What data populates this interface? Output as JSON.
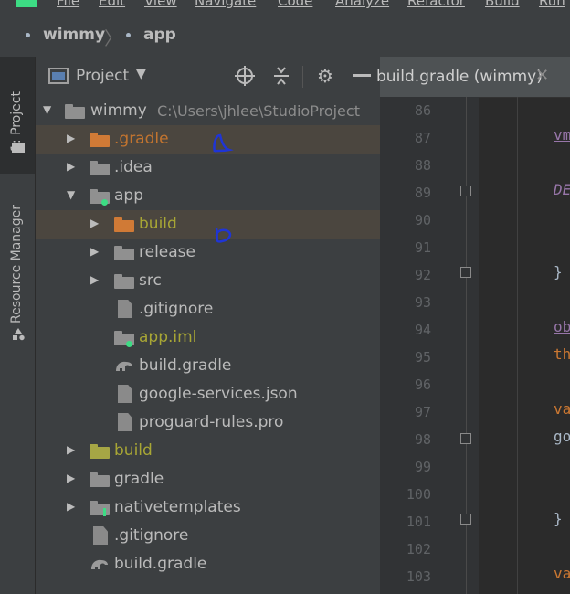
{
  "menu": {
    "items": [
      "File",
      "Edit",
      "View",
      "Navigate",
      "Code",
      "Analyze",
      "Refactor",
      "Build",
      "Run"
    ]
  },
  "breadcrumb": {
    "project": "wimmy",
    "module": "app"
  },
  "toolstrip": {
    "project_tab": "1: Project",
    "resource_tab": "Resource Manager"
  },
  "panel": {
    "title": "Project",
    "icons": [
      "locate-icon",
      "collapse-icon",
      "gear-icon",
      "minimize-icon"
    ]
  },
  "tree": {
    "root": {
      "label": "wimmy",
      "path": "C:\\Users\\jhlee\\StudioProject"
    },
    "items": [
      {
        "label": ".gradle",
        "color": "#c2742f"
      },
      {
        "label": ".idea",
        "color": "#bbbbbb"
      },
      {
        "label": "app",
        "color": "#bbbbbb"
      },
      {
        "label": "build",
        "color": "#a8a635"
      },
      {
        "label": "release",
        "color": "#bbbbbb"
      },
      {
        "label": "src",
        "color": "#bbbbbb"
      },
      {
        "label": ".gitignore",
        "color": "#bbbbbb"
      },
      {
        "label": "app.iml",
        "color": "#a8a635"
      },
      {
        "label": "build.gradle",
        "color": "#bbbbbb"
      },
      {
        "label": "google-services.json",
        "color": "#bbbbbb"
      },
      {
        "label": "proguard-rules.pro",
        "color": "#bbbbbb"
      },
      {
        "label": "build",
        "color": "#a8a635"
      },
      {
        "label": "gradle",
        "color": "#bbbbbb"
      },
      {
        "label": "nativetemplates",
        "color": "#bbbbbb"
      },
      {
        "label": ".gitignore",
        "color": "#bbbbbb"
      },
      {
        "label": "build.gradle",
        "color": "#bbbbbb"
      }
    ]
  },
  "editor": {
    "tab_label": "build.gradle (wimmy)",
    "line_numbers": [
      "86",
      "87",
      "88",
      "89",
      "90",
      "91",
      "92",
      "93",
      "94",
      "95",
      "96",
      "97",
      "98",
      "99",
      "100",
      "101",
      "102",
      "103"
    ],
    "code": [
      {
        "line": "87",
        "text": "vm"
      },
      {
        "line": "89",
        "text": "DE"
      },
      {
        "line": "92",
        "text": "}"
      },
      {
        "line": "94",
        "text": "ob"
      },
      {
        "line": "95",
        "text": "th"
      },
      {
        "line": "97",
        "text": "va"
      },
      {
        "line": "98",
        "text": "go"
      },
      {
        "line": "101",
        "text": "}"
      },
      {
        "line": "103",
        "text": "va"
      }
    ]
  },
  "colors": {
    "annotation_ink": "#1f35d6",
    "accent": "#3ddc84"
  }
}
